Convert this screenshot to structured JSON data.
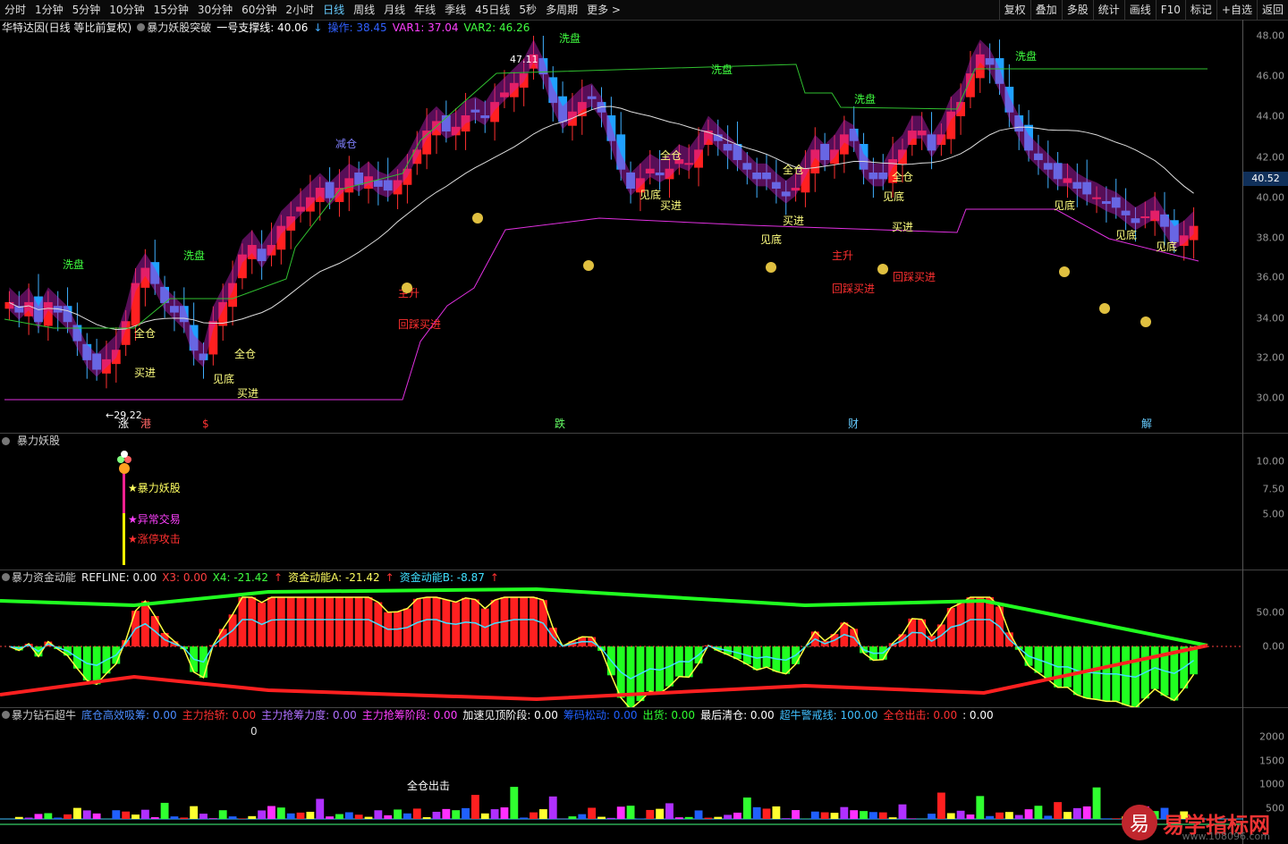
{
  "toolbar": {
    "periods": [
      "分时",
      "1分钟",
      "5分钟",
      "10分钟",
      "15分钟",
      "30分钟",
      "60分钟",
      "2小时",
      "日线",
      "周线",
      "月线",
      "年线",
      "季线",
      "45日线",
      "5秒",
      "多周期",
      "更多 >"
    ],
    "active": "日线",
    "right": [
      "复权",
      "叠加",
      "多股",
      "统计",
      "画线",
      "F10",
      "标记",
      "+自选",
      "返回"
    ]
  },
  "main": {
    "stock": "华特达因(日线 等比前复权)",
    "indicator": "暴力妖股突破",
    "line1": "一号支撑线: 40.06",
    "line2": "操作: 38.45",
    "var1": "VAR1: 37.04",
    "var2": "VAR2: 46.26",
    "yticks": [
      "48.00",
      "46.00",
      "44.00",
      "42.00",
      "40.00",
      "38.00",
      "36.00",
      "34.00",
      "32.00",
      "30.00"
    ],
    "current_price": "40.52",
    "high_label": "47.11",
    "low_label": "29.22",
    "bottom_marks": [
      "涨",
      "港",
      "$",
      "跌",
      "财",
      "解"
    ],
    "labels": {
      "xipan": "洗盘",
      "jiancang": "减仓",
      "quancang": "全仓",
      "mairjin": "买进",
      "jiandi": "见底",
      "zhusheng": "主升",
      "huicai": "回踩买进"
    }
  },
  "p2": {
    "title": "暴力妖股",
    "yticks": [
      "10.00",
      "7.50",
      "5.00"
    ],
    "signals": [
      "暴力妖股",
      "异常交易",
      "涨停攻击"
    ]
  },
  "p3": {
    "title": "暴力资金动能",
    "refline": "REFLINE: 0.00",
    "x3": "X3: 0.00",
    "x4": "X4: -21.42",
    "a": "资金动能A: -21.42",
    "b": "资金动能B: -8.87",
    "yticks": [
      "50.00",
      "0.00"
    ]
  },
  "p4": {
    "title": "暴力钻石超牛",
    "items": [
      {
        "t": "底仓高效吸筹: 0.00",
        "c": "#4a8cff"
      },
      {
        "t": "主力抬轿: 0.00",
        "c": "#ff3030"
      },
      {
        "t": "主力抢筹力度: 0.00",
        "c": "#b070ff"
      },
      {
        "t": "主力抢筹阶段: 0.00",
        "c": "#ff40ff"
      },
      {
        "t": "加速见顶阶段: 0.00",
        "c": "#ffffff"
      },
      {
        "t": "筹码松动: 0.00",
        "c": "#2060ff"
      },
      {
        "t": "出货: 0.00",
        "c": "#30ff30"
      },
      {
        "t": "最后清仓: 0.00",
        "c": "#ffffff"
      },
      {
        "t": "超牛警戒线: 100.00",
        "c": "#40c0ff"
      },
      {
        "t": "全仓出击: 0.00",
        "c": "#ff3030"
      },
      {
        "t": ": 0.00",
        "c": "#ffffff"
      }
    ],
    "zero": "0",
    "yticks": [
      "2000",
      "1500",
      "1000",
      "500"
    ],
    "attack": "全仓出击"
  },
  "logo": {
    "mark": "易",
    "text": "易学指标网",
    "url": "www.108096.com"
  },
  "colors": {
    "up": "#ff2020",
    "down": "#20a0ff",
    "bg": "#000000",
    "magenta": "#ff20ff",
    "green": "#20d020",
    "yellow": "#ffff40",
    "teal": "#1a7fb0"
  }
}
